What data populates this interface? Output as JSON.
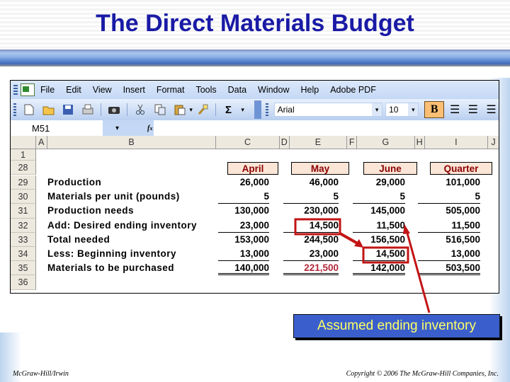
{
  "slide": {
    "title": "The Direct Materials Budget",
    "footer_left": "McGraw-Hill/Irwin",
    "footer_right": "Copyright © 2006 The McGraw-Hill Companies, Inc.",
    "callout": "Assumed ending inventory",
    "accent_colors": {
      "title": "#1a1aa6",
      "callout_bg": "#3a5fcd",
      "callout_text": "#ffff66",
      "highlight": "#c21414"
    }
  },
  "excel": {
    "menu": [
      "File",
      "Edit",
      "View",
      "Insert",
      "Format",
      "Tools",
      "Data",
      "Window",
      "Help",
      "Adobe PDF"
    ],
    "toolbar": {
      "icons": [
        "new-icon",
        "open-icon",
        "save-icon",
        "print-icon",
        "camera-icon",
        "cut-icon",
        "copy-icon",
        "paste-icon",
        "format-painter-icon",
        "autosum-icon"
      ],
      "font": "Arial",
      "size": "10",
      "bold": "B",
      "autosum": "Σ"
    },
    "name_box": "M51",
    "fx": "fx",
    "columns": [
      "A",
      "B",
      "C",
      "D",
      "E",
      "F",
      "G",
      "H",
      "I",
      "J"
    ],
    "month_headers": [
      "April",
      "May",
      "June",
      "Quarter"
    ],
    "rows": [
      {
        "num": "1",
        "label": "",
        "values": [
          "",
          "",
          "",
          ""
        ]
      },
      {
        "num": "28",
        "label": "",
        "values": [
          "April",
          "May",
          "June",
          "Quarter"
        ]
      },
      {
        "num": "29",
        "label": "Production",
        "values": [
          "26,000",
          "46,000",
          "29,000",
          "101,000"
        ]
      },
      {
        "num": "30",
        "label": "Materials per unit (pounds)",
        "values": [
          "5",
          "5",
          "5",
          "5"
        ]
      },
      {
        "num": "31",
        "label": "Production needs",
        "values": [
          "130,000",
          "230,000",
          "145,000",
          "505,000"
        ]
      },
      {
        "num": "32",
        "label": "Add: Desired ending inventory",
        "values": [
          "23,000",
          "14,500",
          "11,500",
          "11,500"
        ]
      },
      {
        "num": "33",
        "label": "Total needed",
        "values": [
          "153,000",
          "244,500",
          "156,500",
          "516,500"
        ]
      },
      {
        "num": "34",
        "label": "Less: Beginning inventory",
        "values": [
          "13,000",
          "23,000",
          "14,500",
          "13,000"
        ]
      },
      {
        "num": "35",
        "label": "Materials to be purchased",
        "values": [
          "140,000",
          "221,500",
          "142,000",
          "503,500"
        ]
      },
      {
        "num": "36",
        "label": "",
        "values": [
          "",
          "",
          "",
          ""
        ]
      }
    ]
  }
}
